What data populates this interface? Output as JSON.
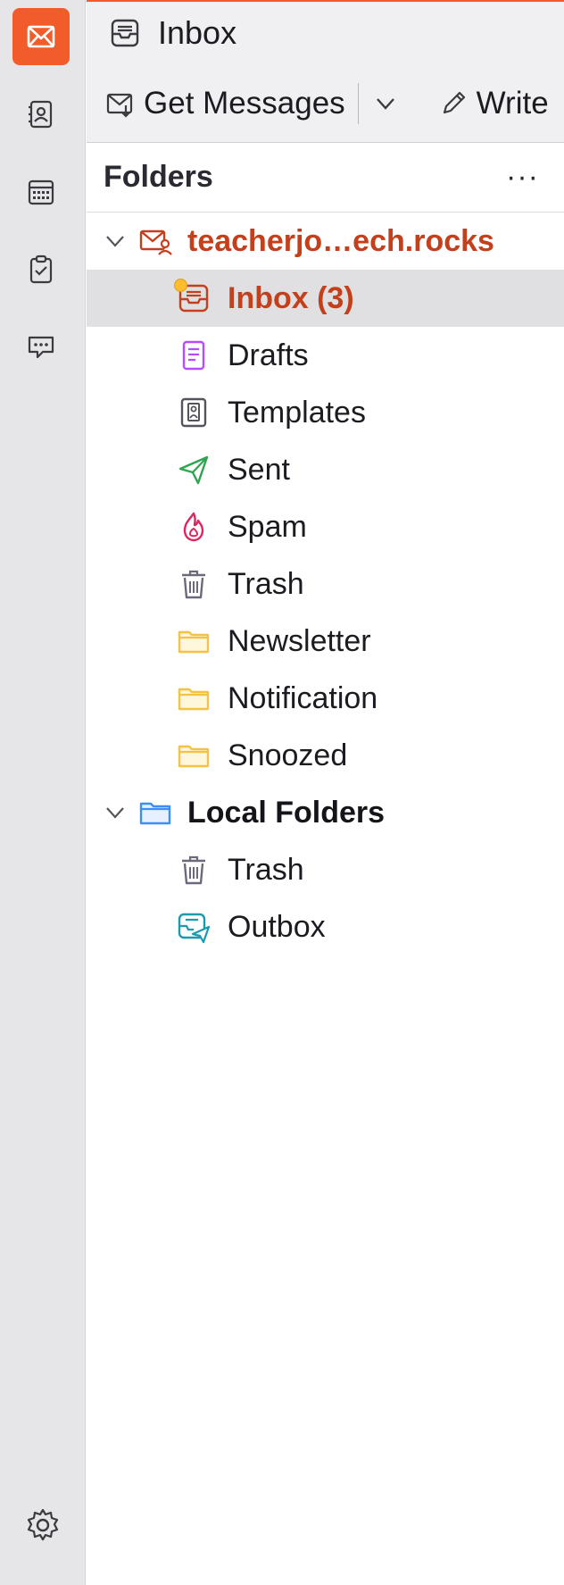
{
  "colors": {
    "accent": "#f25c2a",
    "account_text": "#c4401c",
    "folder_yellow": "#f5c344",
    "sent_green": "#2ea44f",
    "spam_red": "#e0245e",
    "drafts_purple": "#b44dff",
    "outbox_teal": "#1a9bb0",
    "local_blue": "#3d8ef5"
  },
  "spaces": {
    "items": [
      {
        "name": "mail",
        "icon": "mail-icon",
        "active": true
      },
      {
        "name": "address-book",
        "icon": "address-book-icon",
        "active": false
      },
      {
        "name": "calendar",
        "icon": "calendar-icon",
        "active": false
      },
      {
        "name": "tasks",
        "icon": "tasks-icon",
        "active": false
      },
      {
        "name": "chat",
        "icon": "chat-icon",
        "active": false
      }
    ],
    "settings_icon": "gear-icon"
  },
  "tab": {
    "label": "Inbox",
    "icon": "inbox-icon"
  },
  "toolbar": {
    "get_messages_label": "Get Messages",
    "write_label": "Write"
  },
  "folder_pane": {
    "title": "Folders",
    "more_label": "···"
  },
  "folders": {
    "account": {
      "label": "teacherjo…ech.rocks",
      "icon": "account-mail-icon"
    },
    "account_items": [
      {
        "label": "Inbox (3)",
        "icon": "inbox-icon",
        "selected": true
      },
      {
        "label": "Drafts",
        "icon": "drafts-icon"
      },
      {
        "label": "Templates",
        "icon": "templates-icon"
      },
      {
        "label": "Sent",
        "icon": "sent-icon"
      },
      {
        "label": "Spam",
        "icon": "spam-icon"
      },
      {
        "label": "Trash",
        "icon": "trash-icon"
      },
      {
        "label": "Newsletter",
        "icon": "folder-icon"
      },
      {
        "label": "Notification",
        "icon": "folder-icon"
      },
      {
        "label": "Snoozed",
        "icon": "folder-icon"
      }
    ],
    "local": {
      "label": "Local Folders",
      "icon": "local-folder-icon"
    },
    "local_items": [
      {
        "label": "Trash",
        "icon": "trash-icon"
      },
      {
        "label": "Outbox",
        "icon": "outbox-icon"
      }
    ]
  }
}
